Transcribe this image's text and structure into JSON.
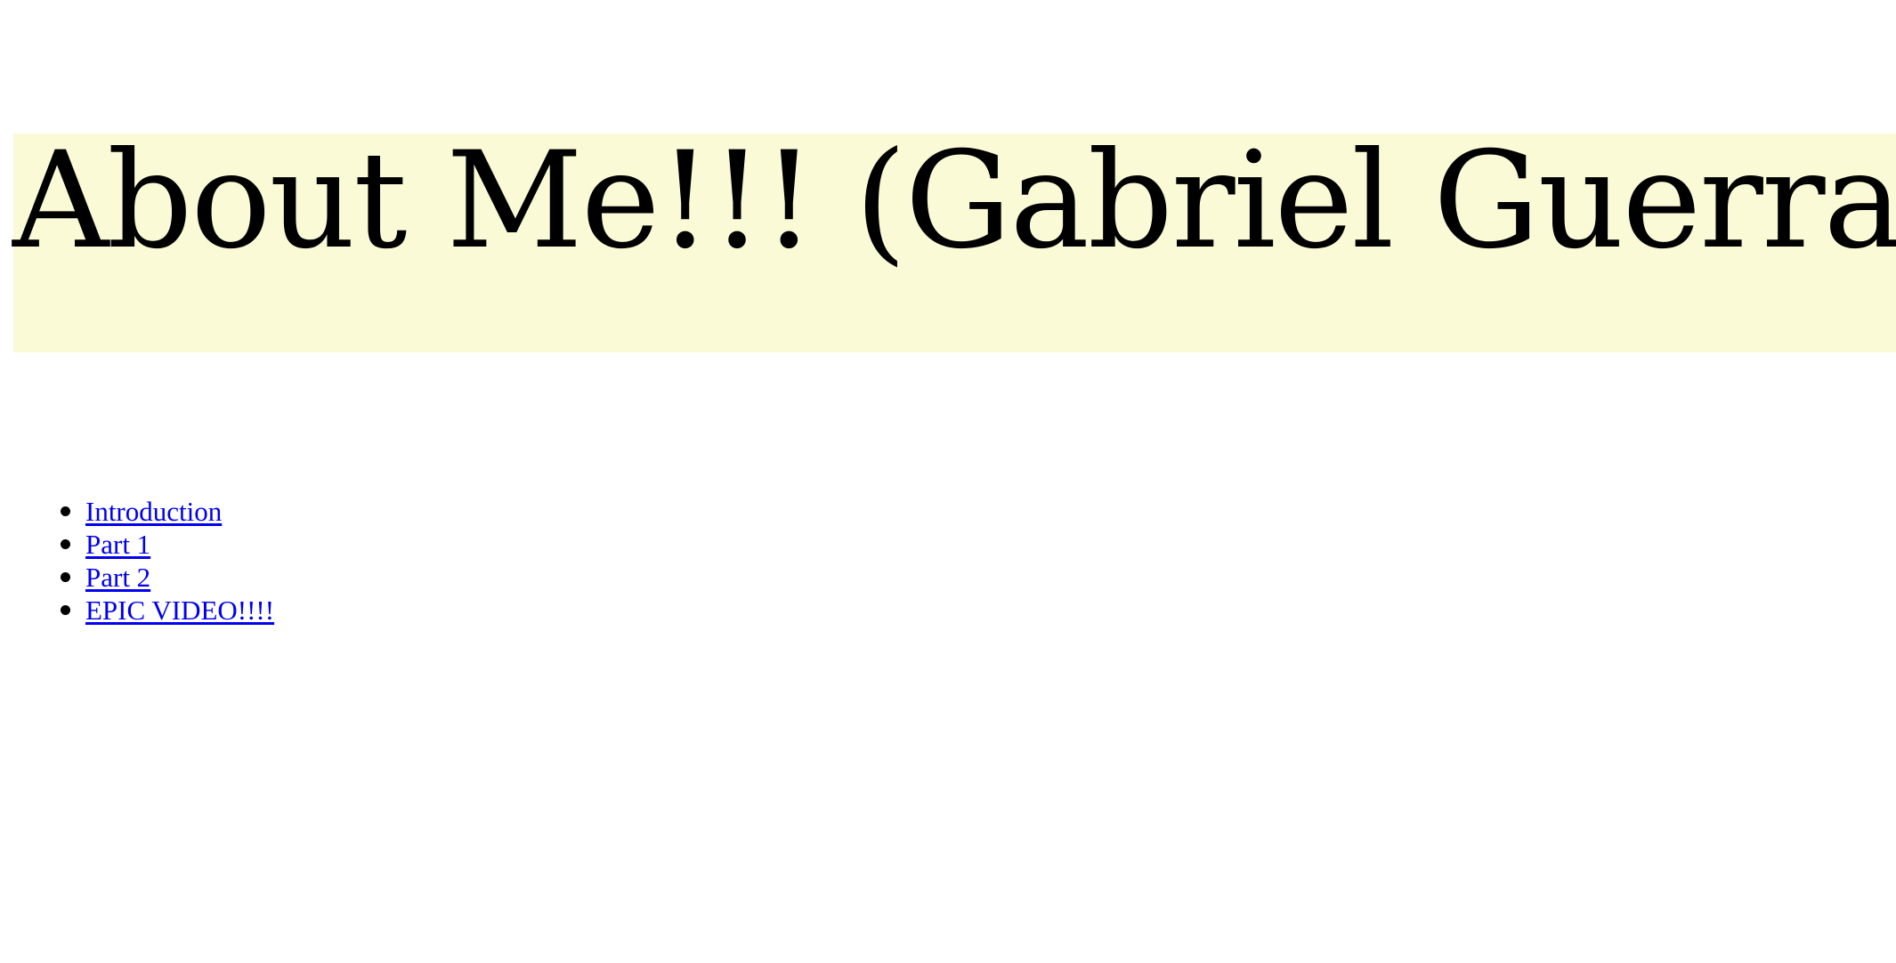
{
  "header": {
    "title": "About Me!!! (Gabriel Guerra)"
  },
  "nav": {
    "items": [
      {
        "label": "Introduction"
      },
      {
        "label": "Part 1"
      },
      {
        "label": "Part 2"
      },
      {
        "label": "EPIC VIDEO!!!!"
      }
    ]
  },
  "colors": {
    "banner_background": "#fafad7",
    "link": "#0000ee"
  }
}
